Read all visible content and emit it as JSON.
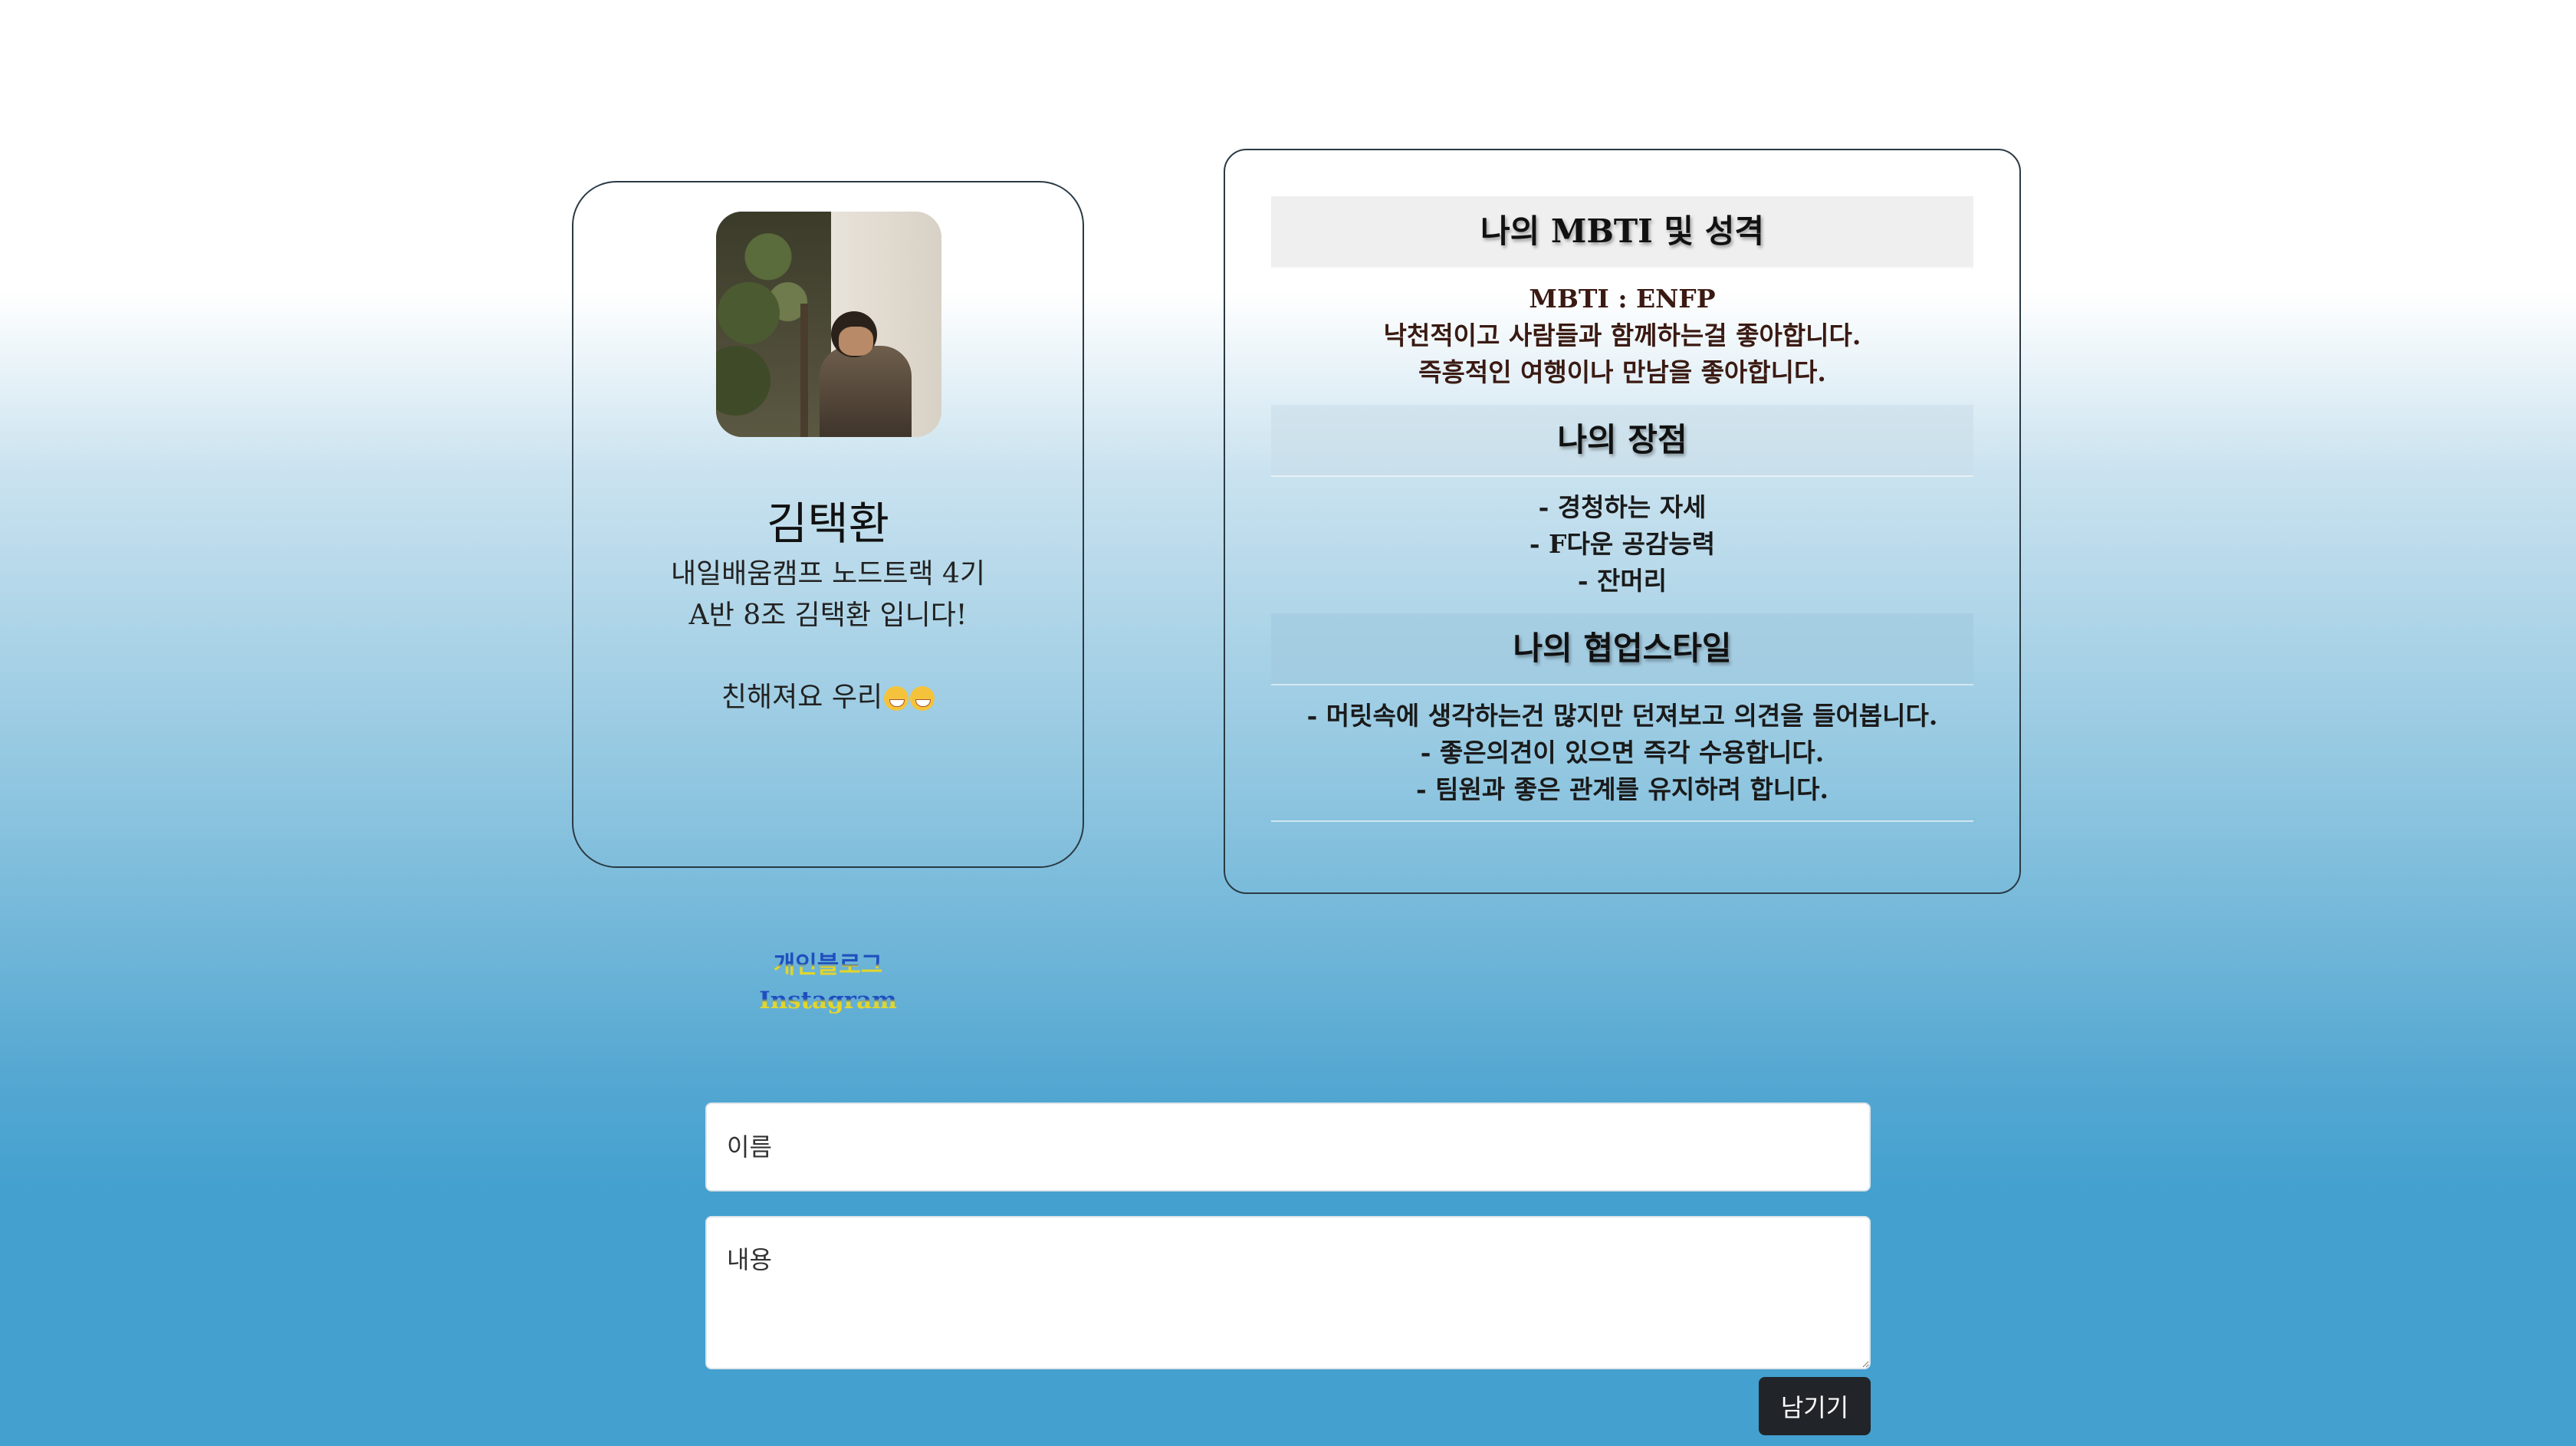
{
  "profile": {
    "name": "김택환",
    "desc_line1": "내일배움캠프 노드트랙 4기",
    "desc_line2": "A반 8조 김택환 입니다!",
    "greeting": "친해져요 우리",
    "links": [
      "개인블로그",
      "Instagram"
    ]
  },
  "info": {
    "sections": [
      {
        "title": "나의 MBTI 및 성격",
        "lines": [
          "MBTI : ENFP",
          "낙천적이고 사람들과 함께하는걸 좋아합니다.",
          "즉흥적인 여행이나 만남을 좋아합니다."
        ]
      },
      {
        "title": "나의 장점",
        "lines": [
          "- 경청하는 자세",
          "- F다운 공감능력",
          "- 잔머리"
        ]
      },
      {
        "title": "나의 협업스타일",
        "lines": [
          "- 머릿속에 생각하는건 많지만 던져보고 의견을 들어봅니다.",
          "- 좋은의견이 있으면 즉각 수용합니다.",
          "- 팀원과 좋은 관계를 유지하려 합니다."
        ]
      }
    ]
  },
  "form": {
    "name_placeholder": "이름",
    "content_placeholder": "내용",
    "submit_label": "남기기"
  }
}
